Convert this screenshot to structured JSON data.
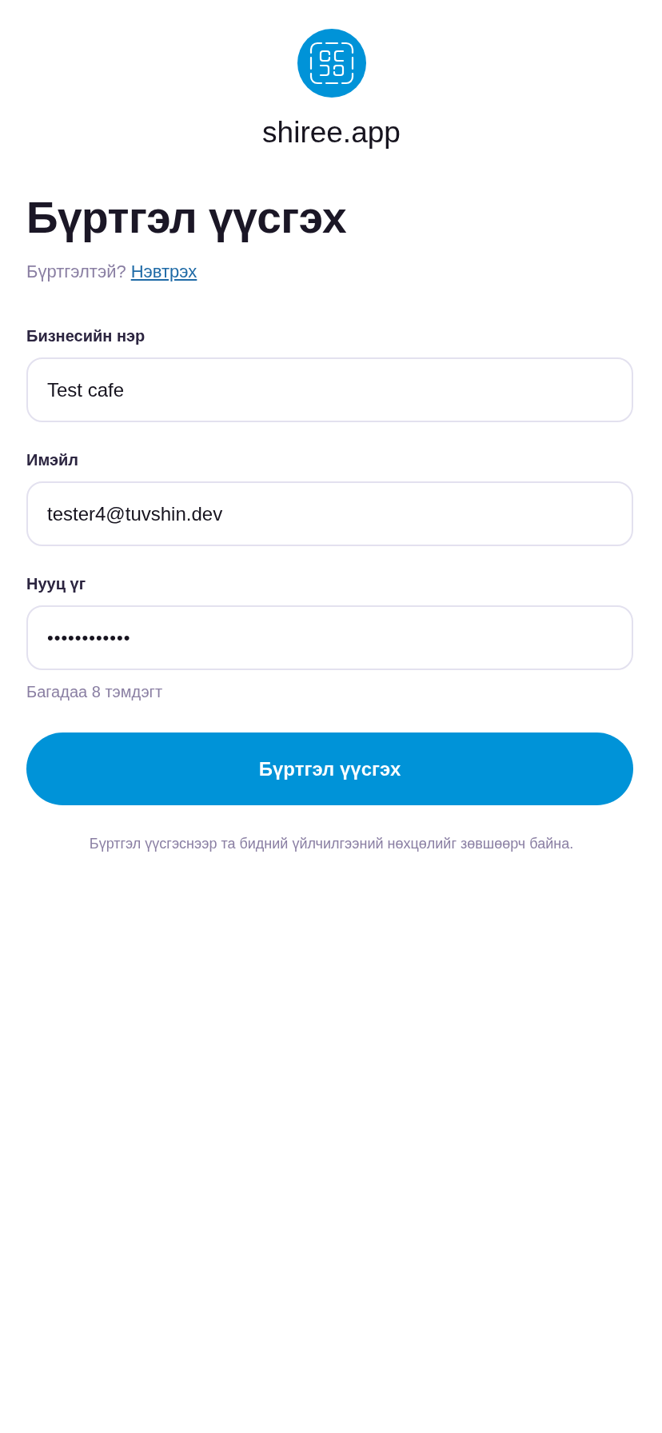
{
  "brand": {
    "name": "shiree.app"
  },
  "heading": "Бүртгэл үүсгэх",
  "signin_prompt": {
    "text": "Бүртгэлтэй?",
    "link": "Нэвтрэх"
  },
  "fields": [
    {
      "kind": "text",
      "label": "Бизнесийн нэр",
      "value": "Test cafe"
    },
    {
      "kind": "email",
      "label": "Имэйл",
      "value": "tester4@tuvshin.dev"
    },
    {
      "kind": "password",
      "label": "Нууц үг",
      "value": "••••••••••••",
      "hint": "Багадаа 8 тэмдэгт"
    }
  ],
  "submit_button": "Бүртгэл үүсгэх",
  "terms_note": "Бүртгэл үүсгэснээр та бидний үйлчилгээний нөхцөлийг зөвшөөрч байна."
}
